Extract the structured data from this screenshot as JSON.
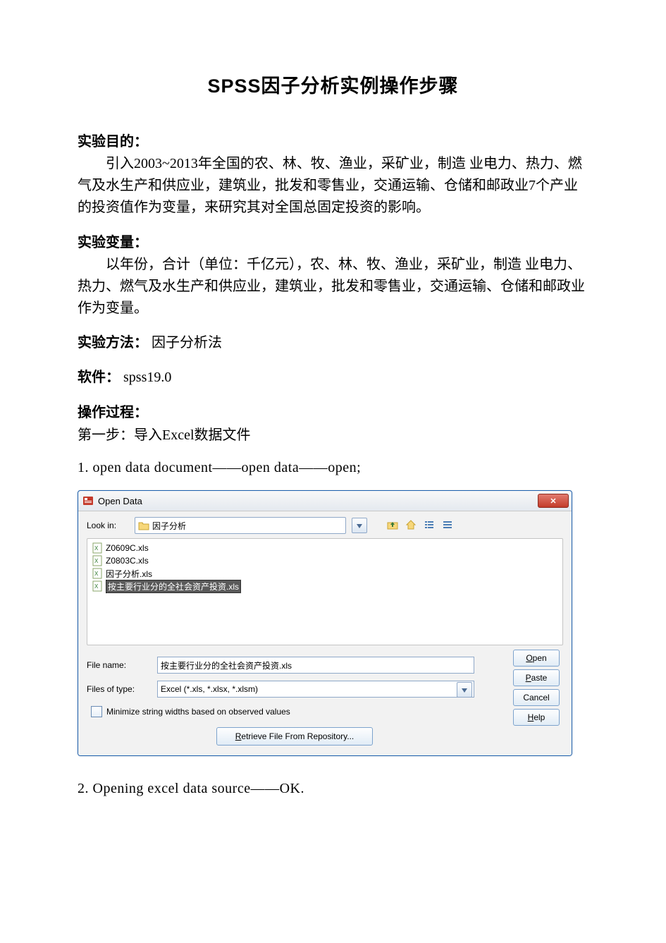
{
  "doc": {
    "title": "SPSS因子分析实例操作步骤",
    "h_purpose": "实验目的：",
    "purpose_text": "引入2003~2013年全国的农、林、牧、渔业，采矿业，制造 业电力、热力、燃气及水生产和供应业，建筑业，批发和零售业，交通运输、仓储和邮政业7个产业的投资值作为变量，来研究其对全国总固定投资的影响。",
    "h_vars": "实验变量：",
    "vars_text": "以年份，合计（单位：千亿元），农、林、牧、渔业，采矿业，制造 业电力、热力、燃气及水生产和供应业，建筑业，批发和零售业，交通运输、仓储和邮政业作为变量。",
    "h_method": "实验方法：",
    "method_val": "因子分析法",
    "h_soft": "软件：",
    "soft_val": "spss19.0",
    "h_proc": "操作过程：",
    "step1_head": "第一步：导入Excel数据文件",
    "step1_line": "1. open data document——open data——open;",
    "step2_line": "2. Opening excel data source——OK."
  },
  "dialog": {
    "title": "Open Data",
    "lookin_label": "Look in:",
    "lookin_value": "因子分析",
    "files": [
      "Z0609C.xls",
      "Z0803C.xls",
      "因子分析.xls",
      "按主要行业分的全社会资产投资.xls"
    ],
    "filename_label": "File name:",
    "filename_value": "按主要行业分的全社会资产投资.xls",
    "filetype_label": "Files of type:",
    "filetype_value": "Excel (*.xls, *.xlsx, *.xlsm)",
    "minimize_label": "Minimize string widths based on observed values",
    "repo_btn": "Retrieve File From Repository...",
    "btn_open": "Open",
    "btn_paste": "Paste",
    "btn_cancel": "Cancel",
    "btn_help": "Help"
  }
}
